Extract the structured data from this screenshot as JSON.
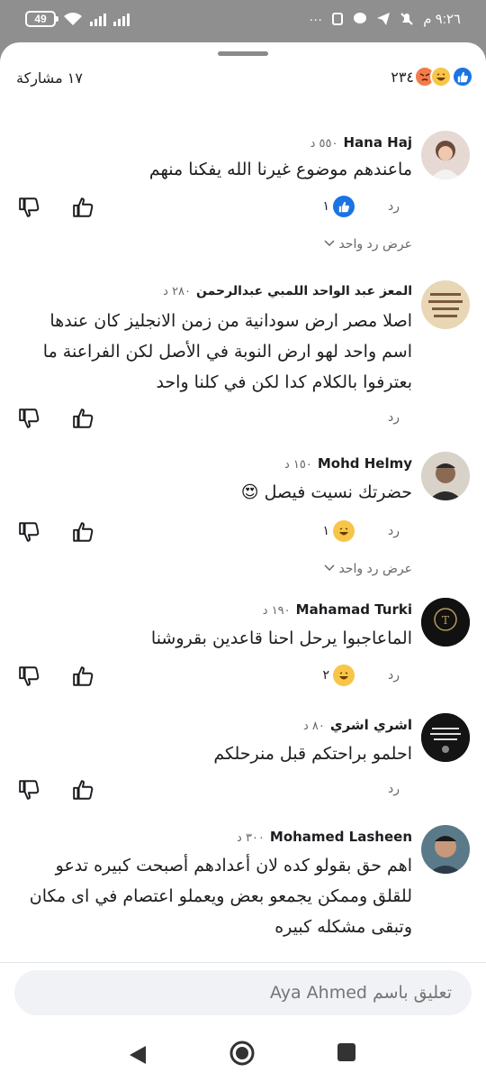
{
  "status_bar": {
    "time": "٩:٢٦ م",
    "battery": "49",
    "extra_icons": "···"
  },
  "header": {
    "share_count": "١٧ مشاركة",
    "reaction_count": "٢٣٤",
    "reaction_icons": [
      "like",
      "haha",
      "angry"
    ]
  },
  "comments": [
    {
      "author": "Hana Haj",
      "time": "٥٥٠ د",
      "text": "ماعندهم موضوع غيرنا الله يفكنا منهم",
      "reply_label": "رد",
      "reaction_count": "١",
      "reaction_icon": "like",
      "view_replies": "عرض رد واحد"
    },
    {
      "author": "المعز عبد الواحد اللمبي عبدالرحمن",
      "time": "٢٨٠ د",
      "text": "اصلا مصر ارض سودانية من زمن الانجليز كان عندها اسم واحد لهو ارض النوبة في الأصل لكن الفراعنة ما بعترفوا بالكلام كدا لكن في كلنا واحد",
      "reply_label": "رد"
    },
    {
      "author": "Mohd Helmy",
      "time": "١٥٠ د",
      "text": "حضرتك نسيت فيصل",
      "emoji": "😍",
      "reply_label": "رد",
      "reaction_count": "١",
      "reaction_icon": "haha",
      "view_replies": "عرض رد واحد"
    },
    {
      "author": "Mahamad Turki",
      "time": "١٩٠ د",
      "text": "الماعاجبوا يرحل احنا قاعدين بقروشنا",
      "reply_label": "رد",
      "reaction_count": "٢",
      "reaction_icon": "haha",
      "avatar_text": "AUTORKI"
    },
    {
      "author": "اشري اشري",
      "time": "٨٠ د",
      "text": "احلمو براحتكم قبل منرحلكم",
      "reply_label": "رد"
    },
    {
      "author": "Mohamed Lasheen",
      "time": "٣٠٠ د",
      "text": "اهم حق بقولو كده لان أعدادهم أصبحت كبيره تدعو للقلق وممكن يجمعو بعض ويعملو اعتصام في اى مكان وتبقى مشكله كبيره"
    }
  ],
  "composer": {
    "placeholder": "تعليق باسم Aya Ahmed"
  },
  "colors": {
    "like_blue": "#1b74e4",
    "haha_yellow": "#f7c548",
    "angry_orange": "#f27c4a",
    "status_bar_bg": "#8f8f8f"
  }
}
